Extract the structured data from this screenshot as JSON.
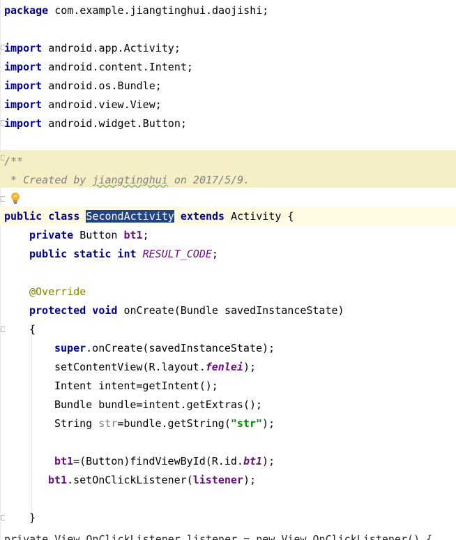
{
  "editor": {
    "package_kw": "package",
    "package_name": " com.example.jiangtinghui.daojishi;",
    "import_kw": "import",
    "imports": [
      " android.app.Activity;",
      " android.content.Intent;",
      " android.os.Bundle;",
      " android.view.View;",
      " android.widget.Button;"
    ],
    "comment_open": "/**",
    "comment_body_prefix": " * Created by ",
    "comment_author": "jiangtinghui",
    "comment_body_suffix": " on 2017/5/9.",
    "class_public": "public",
    "class_kw": " class ",
    "class_name": "SecondActivity",
    "extends_kw": " extends ",
    "extends_rest": "Activity {",
    "field1_mod": "private",
    "field1_type": " Button ",
    "field1_name": "bt1",
    "field1_end": ";",
    "field2_mod": "public static int",
    "field2_name": "RESULT_CODE",
    "field2_end": ";",
    "annotation": "@Override",
    "method_mod": "protected void",
    "method_sig": " onCreate(Bundle savedInstanceState)",
    "open_brace": "{",
    "super_kw": "super",
    "super_rest": ".onCreate(savedInstanceState);",
    "set_content_a": "setContentView(R.layout.",
    "set_content_field": "fenlei",
    "set_content_b": ");",
    "intent_line": "Intent intent=getIntent();",
    "bundle_line": "Bundle bundle=intent.getExtras();",
    "string_a": "String ",
    "string_var": "str",
    "string_b": "=bundle.getString(",
    "string_lit": "\"str\"",
    "string_c": ");",
    "bt1_assign_field": "bt1",
    "bt1_assign_mid": "=(Button)findViewById(R.id.",
    "bt1_assign_id": "bt1",
    "bt1_assign_end": ");",
    "listener_field": "bt1",
    "listener_mid": ".setOnClickListener(",
    "listener_arg": "listener",
    "listener_end": ");",
    "close_brace": "}",
    "cutoff_text": "    private View.OnClickListener listener = new View.OnClickListener() {"
  }
}
